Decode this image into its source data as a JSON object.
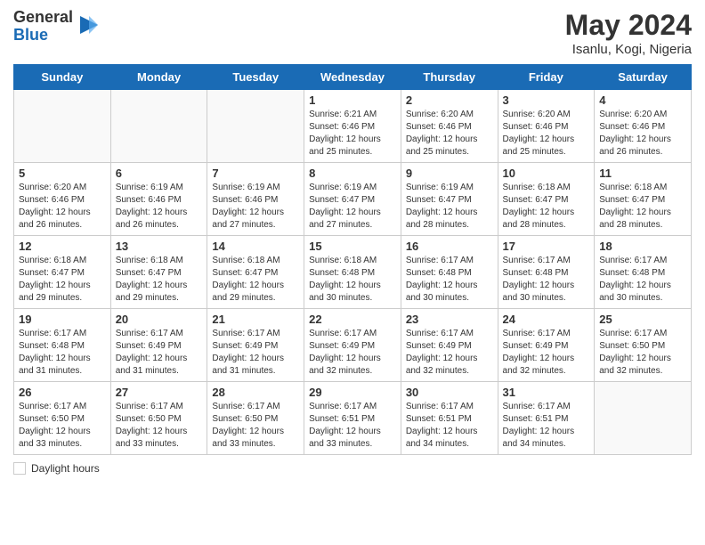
{
  "header": {
    "logo_general": "General",
    "logo_blue": "Blue",
    "month_year": "May 2024",
    "location": "Isanlu, Kogi, Nigeria"
  },
  "days_of_week": [
    "Sunday",
    "Monday",
    "Tuesday",
    "Wednesday",
    "Thursday",
    "Friday",
    "Saturday"
  ],
  "weeks": [
    {
      "days": [
        {
          "num": "",
          "info": ""
        },
        {
          "num": "",
          "info": ""
        },
        {
          "num": "",
          "info": ""
        },
        {
          "num": "1",
          "info": "Sunrise: 6:21 AM\nSunset: 6:46 PM\nDaylight: 12 hours and 25 minutes."
        },
        {
          "num": "2",
          "info": "Sunrise: 6:20 AM\nSunset: 6:46 PM\nDaylight: 12 hours and 25 minutes."
        },
        {
          "num": "3",
          "info": "Sunrise: 6:20 AM\nSunset: 6:46 PM\nDaylight: 12 hours and 25 minutes."
        },
        {
          "num": "4",
          "info": "Sunrise: 6:20 AM\nSunset: 6:46 PM\nDaylight: 12 hours and 26 minutes."
        }
      ]
    },
    {
      "days": [
        {
          "num": "5",
          "info": "Sunrise: 6:20 AM\nSunset: 6:46 PM\nDaylight: 12 hours and 26 minutes."
        },
        {
          "num": "6",
          "info": "Sunrise: 6:19 AM\nSunset: 6:46 PM\nDaylight: 12 hours and 26 minutes."
        },
        {
          "num": "7",
          "info": "Sunrise: 6:19 AM\nSunset: 6:46 PM\nDaylight: 12 hours and 27 minutes."
        },
        {
          "num": "8",
          "info": "Sunrise: 6:19 AM\nSunset: 6:47 PM\nDaylight: 12 hours and 27 minutes."
        },
        {
          "num": "9",
          "info": "Sunrise: 6:19 AM\nSunset: 6:47 PM\nDaylight: 12 hours and 28 minutes."
        },
        {
          "num": "10",
          "info": "Sunrise: 6:18 AM\nSunset: 6:47 PM\nDaylight: 12 hours and 28 minutes."
        },
        {
          "num": "11",
          "info": "Sunrise: 6:18 AM\nSunset: 6:47 PM\nDaylight: 12 hours and 28 minutes."
        }
      ]
    },
    {
      "days": [
        {
          "num": "12",
          "info": "Sunrise: 6:18 AM\nSunset: 6:47 PM\nDaylight: 12 hours and 29 minutes."
        },
        {
          "num": "13",
          "info": "Sunrise: 6:18 AM\nSunset: 6:47 PM\nDaylight: 12 hours and 29 minutes."
        },
        {
          "num": "14",
          "info": "Sunrise: 6:18 AM\nSunset: 6:47 PM\nDaylight: 12 hours and 29 minutes."
        },
        {
          "num": "15",
          "info": "Sunrise: 6:18 AM\nSunset: 6:48 PM\nDaylight: 12 hours and 30 minutes."
        },
        {
          "num": "16",
          "info": "Sunrise: 6:17 AM\nSunset: 6:48 PM\nDaylight: 12 hours and 30 minutes."
        },
        {
          "num": "17",
          "info": "Sunrise: 6:17 AM\nSunset: 6:48 PM\nDaylight: 12 hours and 30 minutes."
        },
        {
          "num": "18",
          "info": "Sunrise: 6:17 AM\nSunset: 6:48 PM\nDaylight: 12 hours and 30 minutes."
        }
      ]
    },
    {
      "days": [
        {
          "num": "19",
          "info": "Sunrise: 6:17 AM\nSunset: 6:48 PM\nDaylight: 12 hours and 31 minutes."
        },
        {
          "num": "20",
          "info": "Sunrise: 6:17 AM\nSunset: 6:49 PM\nDaylight: 12 hours and 31 minutes."
        },
        {
          "num": "21",
          "info": "Sunrise: 6:17 AM\nSunset: 6:49 PM\nDaylight: 12 hours and 31 minutes."
        },
        {
          "num": "22",
          "info": "Sunrise: 6:17 AM\nSunset: 6:49 PM\nDaylight: 12 hours and 32 minutes."
        },
        {
          "num": "23",
          "info": "Sunrise: 6:17 AM\nSunset: 6:49 PM\nDaylight: 12 hours and 32 minutes."
        },
        {
          "num": "24",
          "info": "Sunrise: 6:17 AM\nSunset: 6:49 PM\nDaylight: 12 hours and 32 minutes."
        },
        {
          "num": "25",
          "info": "Sunrise: 6:17 AM\nSunset: 6:50 PM\nDaylight: 12 hours and 32 minutes."
        }
      ]
    },
    {
      "days": [
        {
          "num": "26",
          "info": "Sunrise: 6:17 AM\nSunset: 6:50 PM\nDaylight: 12 hours and 33 minutes."
        },
        {
          "num": "27",
          "info": "Sunrise: 6:17 AM\nSunset: 6:50 PM\nDaylight: 12 hours and 33 minutes."
        },
        {
          "num": "28",
          "info": "Sunrise: 6:17 AM\nSunset: 6:50 PM\nDaylight: 12 hours and 33 minutes."
        },
        {
          "num": "29",
          "info": "Sunrise: 6:17 AM\nSunset: 6:51 PM\nDaylight: 12 hours and 33 minutes."
        },
        {
          "num": "30",
          "info": "Sunrise: 6:17 AM\nSunset: 6:51 PM\nDaylight: 12 hours and 34 minutes."
        },
        {
          "num": "31",
          "info": "Sunrise: 6:17 AM\nSunset: 6:51 PM\nDaylight: 12 hours and 34 minutes."
        },
        {
          "num": "",
          "info": ""
        }
      ]
    }
  ],
  "footer": {
    "label": "Daylight hours"
  }
}
